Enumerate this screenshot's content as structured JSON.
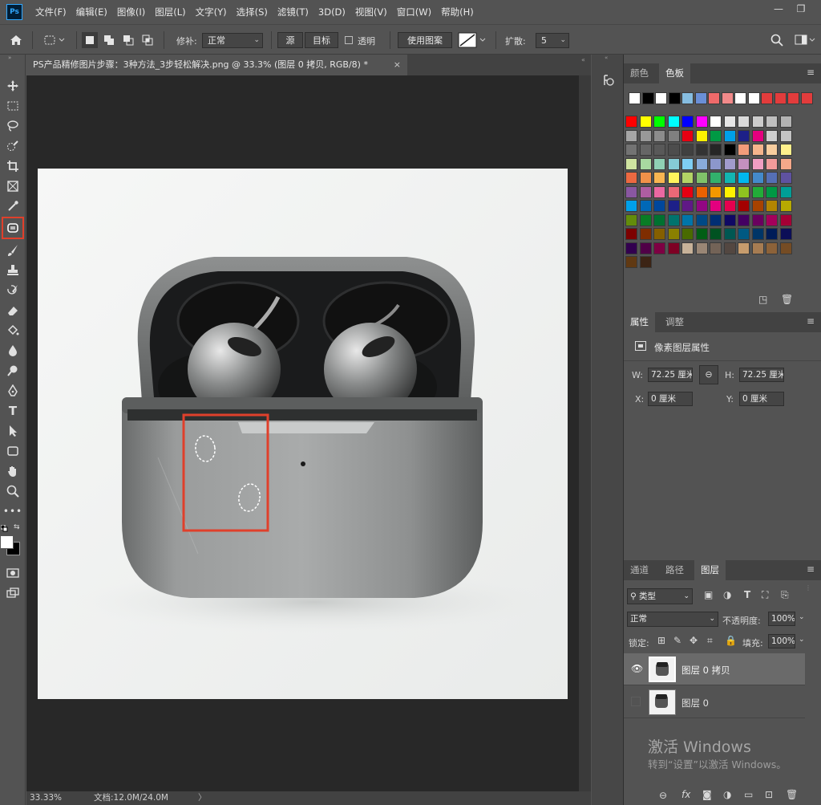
{
  "menu": {
    "logo": "Ps",
    "items": [
      "文件(F)",
      "编辑(E)",
      "图像(I)",
      "图层(L)",
      "文字(Y)",
      "选择(S)",
      "滤镜(T)",
      "3D(D)",
      "视图(V)",
      "窗口(W)",
      "帮助(H)"
    ],
    "minimize": "—",
    "restore": "❐"
  },
  "options": {
    "patch_label": "修补:",
    "patch_mode": "正常",
    "source_label": "源",
    "dest_label": "目标",
    "transparent_label": "透明",
    "use_pattern_label": "使用图案",
    "diffuse_label": "扩散:",
    "diffuse_value": "5"
  },
  "document": {
    "tab_title": "PS产品精修图片步骤：3种方法_3步轻松解决.png @ 33.3% (图层 0 拷贝, RGB/8) *",
    "close": "×",
    "zoom": "33.33%",
    "doc_size": "文档:12.0M/24.0M",
    "status_arrow": "〉"
  },
  "swatch_panel": {
    "tabs": [
      "颜色",
      "色板"
    ],
    "active_tab": "色板",
    "recent": [
      "#ffffff",
      "#000000",
      "#ffffff",
      "#000000",
      "#86bde0",
      "#6a8fd6",
      "#ef6a6a",
      "#f28a8a",
      "#ffffff",
      "#ffffff",
      "#e23c3c",
      "#e23c3c",
      "#e23c3c",
      "#e23c3c"
    ],
    "grid": [
      [
        "#ff0000",
        "#ffff00",
        "#00ff00",
        "#00ffff",
        "#0000ff",
        "#ff00ff",
        "#ffffff",
        "#e6e6e6",
        "#d9d9d9",
        "#cccccc",
        "#bfbfbf",
        "#b3b3b3"
      ],
      [
        "#a6a6a6",
        "#999999",
        "#8c8c8c",
        "#808080",
        "#e60012",
        "#fff100",
        "#009944",
        "#00a0e9",
        "#1d2088",
        "#e4007f",
        "#cfcfcf",
        "#c3c3c3"
      ],
      [
        "#737373",
        "#666666",
        "#595959",
        "#4d4d4d",
        "#404040",
        "#333333",
        "#262626",
        "#000000",
        "#f29c7a",
        "#f5b48c",
        "#f8cd9e",
        "#fff08c"
      ],
      [
        "#cfe3a0",
        "#a8d8a0",
        "#8fd0b4",
        "#86cbd6",
        "#7ecef4",
        "#88abda",
        "#8c97cb",
        "#a19bcc",
        "#c490bf",
        "#f19ec2",
        "#f29b9b",
        "#f6a88a"
      ],
      [
        "#ec6941",
        "#f19149",
        "#f8b551",
        "#fff45c",
        "#b3d465",
        "#80c269",
        "#32b16c",
        "#13b5b1",
        "#00b7ee",
        "#448aca",
        "#556fb5",
        "#5f52a0"
      ],
      [
        "#8957a1",
        "#ae5da1",
        "#ea68a2",
        "#eb6877",
        "#e60012",
        "#eb6100",
        "#f39800",
        "#fff100",
        "#8fc31f",
        "#22ac38",
        "#009944",
        "#009e96"
      ],
      [
        "#00a0e9",
        "#0068b7",
        "#00479d",
        "#1d2088",
        "#601986",
        "#920783",
        "#e4007f",
        "#e5004f",
        "#a40000",
        "#a84200",
        "#b28500",
        "#b7aa00"
      ],
      [
        "#638c0b",
        "#097c25",
        "#007130",
        "#00736d",
        "#0075a9",
        "#004986",
        "#002e73",
        "#100964",
        "#440062",
        "#6a005f",
        "#a4005b",
        "#a40035"
      ],
      [
        "#7d0000",
        "#7f2d00",
        "#855f00",
        "#8a8000",
        "#496a00",
        "#005e15",
        "#005221",
        "#005752",
        "#005982",
        "#003567",
        "#001c58",
        "#0c0e57"
      ],
      [
        "#32004f",
        "#500047",
        "#7e0043",
        "#7e0024",
        "#c7b299",
        "#998675",
        "#736357",
        "#534741",
        "#c69c6d",
        "#a67c52",
        "#8c6239",
        "#754c24"
      ],
      [
        "#603913",
        "#3c2415"
      ]
    ]
  },
  "properties_panel": {
    "tabs": [
      "属性",
      "调整"
    ],
    "active_tab": "属性",
    "title": "像素图层属性",
    "w_label": "W:",
    "w_value": "72.25 厘米",
    "h_label": "H:",
    "h_value": "72.25 厘米",
    "x_label": "X:",
    "x_value": "0 厘米",
    "y_label": "Y:",
    "y_value": "0 厘米"
  },
  "layers_panel": {
    "tabs": [
      "通道",
      "路径",
      "图层"
    ],
    "active_tab": "图层",
    "filter_kind": "类型",
    "blend_mode": "正常",
    "opacity_label": "不透明度:",
    "opacity_value": "100%",
    "lock_label": "锁定:",
    "fill_label": "填充:",
    "fill_value": "100%",
    "layers": [
      {
        "name": "图层 0 拷贝",
        "visible": true,
        "selected": true
      },
      {
        "name": "图层 0",
        "visible": false,
        "selected": false
      }
    ],
    "footer_fx": "fx"
  },
  "watermark": {
    "line1": "激活 Windows",
    "line2": "转到“设置”以激活 Windows。"
  },
  "colors": {
    "highlight": "#e0402b",
    "panel": "#535353",
    "canvas": "#282828"
  }
}
